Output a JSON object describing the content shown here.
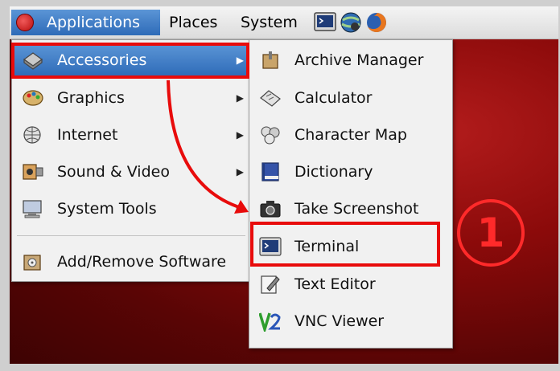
{
  "panel": {
    "menus": [
      "Applications",
      "Places",
      "System"
    ],
    "launchers": [
      "terminal-icon",
      "network-icon",
      "firefox-icon"
    ]
  },
  "applications_menu": {
    "items": [
      {
        "label": "Accessories",
        "icon": "accessories-icon",
        "has_submenu": true
      },
      {
        "label": "Graphics",
        "icon": "graphics-icon",
        "has_submenu": true
      },
      {
        "label": "Internet",
        "icon": "internet-icon",
        "has_submenu": true
      },
      {
        "label": "Sound & Video",
        "icon": "sound-video-icon",
        "has_submenu": true
      },
      {
        "label": "System Tools",
        "icon": "system-tools-icon",
        "has_submenu": true
      },
      {
        "label": "Add/Remove Software",
        "icon": "add-remove-software-icon",
        "has_submenu": false
      }
    ]
  },
  "accessories_menu": {
    "items": [
      {
        "label": "Archive Manager",
        "icon": "archive-manager-icon"
      },
      {
        "label": "Calculator",
        "icon": "calculator-icon"
      },
      {
        "label": "Character Map",
        "icon": "character-map-icon"
      },
      {
        "label": "Dictionary",
        "icon": "dictionary-icon"
      },
      {
        "label": "Take Screenshot",
        "icon": "camera-icon"
      },
      {
        "label": "Terminal",
        "icon": "terminal-icon"
      },
      {
        "label": "Text Editor",
        "icon": "text-editor-icon"
      },
      {
        "label": "VNC Viewer",
        "icon": "vnc-viewer-icon"
      }
    ]
  },
  "annotation": {
    "step_number": "1",
    "highlight_color": "#e80b0b"
  },
  "colors": {
    "menu_highlight": "#3a7ac4",
    "desktop": "#8b0a0a"
  }
}
